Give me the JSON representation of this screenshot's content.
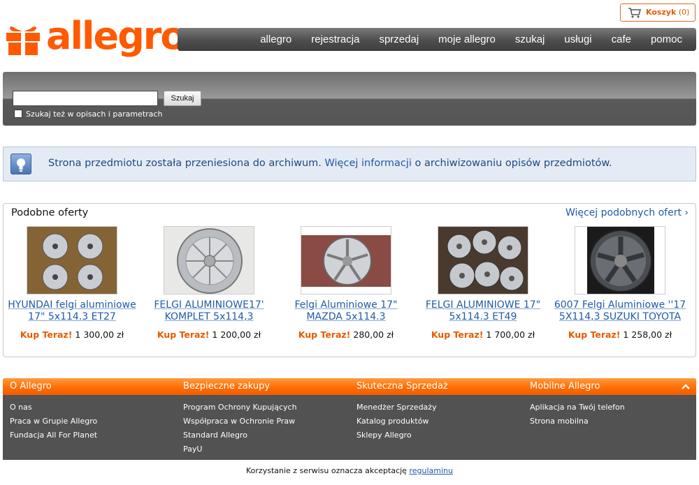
{
  "header": {
    "logo_text": "allegro",
    "cart_label": "Koszyk",
    "cart_count": "(0)",
    "nav": [
      "allegro",
      "rejestracja",
      "sprzedaj",
      "moje allegro",
      "szukaj",
      "usługi",
      "cafe",
      "pomoc"
    ]
  },
  "search": {
    "button_label": "Szukaj",
    "input_value": "",
    "checkbox_label": "Szukaj też w opisach i parametrach"
  },
  "info": {
    "text_before": "Strona przedmiotu została przeniesiona do archiwum. ",
    "link": "Więcej informacji",
    "text_after": " o archiwizowaniu opisów przedmiotów."
  },
  "similar": {
    "title": "Podobne oferty",
    "more_link": "Więcej podobnych ofert ›",
    "buy_label": "Kup Teraz!",
    "items": [
      {
        "title": "HYUNDAI felgi aluminiowe 17\" 5x114.3 ET27",
        "price": "1 300,00 zł"
      },
      {
        "title": "FELGI ALUMINIOWE17' KOMPLET 5x114,3",
        "price": "1 200,00 zł"
      },
      {
        "title": "Felgi Aluminiowe 17\" MAZDA 5x114.3",
        "price": "280,00 zł"
      },
      {
        "title": "FELGI ALUMINIOWE 17\" 5x114.3 ET49",
        "price": "1 700,00 zł"
      },
      {
        "title": "6007 Felgi Aluminiowe ''17 5X114,3 SUZUKI TOYOTA",
        "price": "1 258,00 zł"
      }
    ]
  },
  "footer": {
    "columns": [
      {
        "title": "O Allegro",
        "links": [
          "O nas",
          "Praca w Grupie Allegro",
          "Fundacja All For Planet"
        ]
      },
      {
        "title": "Bezpieczne zakupy",
        "links": [
          "Program Ochrony Kupujących",
          "Współpraca w Ochronie Praw",
          "Standard Allegro",
          "PayU"
        ]
      },
      {
        "title": "Skuteczna Sprzedaż",
        "links": [
          "Menedżer Sprzedaży",
          "Katalog produktów",
          "Sklepy Allegro"
        ]
      },
      {
        "title": "Mobilne Allegro",
        "links": [
          "Aplikacja na Twój telefon",
          "Strona mobilna"
        ]
      }
    ],
    "terms_text": "Korzystanie z serwisu oznacza akceptację ",
    "terms_link": "regulaminu"
  },
  "colors": {
    "brand_orange": "#ff5a00",
    "link_blue": "#1f5aa8",
    "buy_orange": "#e65a00"
  }
}
